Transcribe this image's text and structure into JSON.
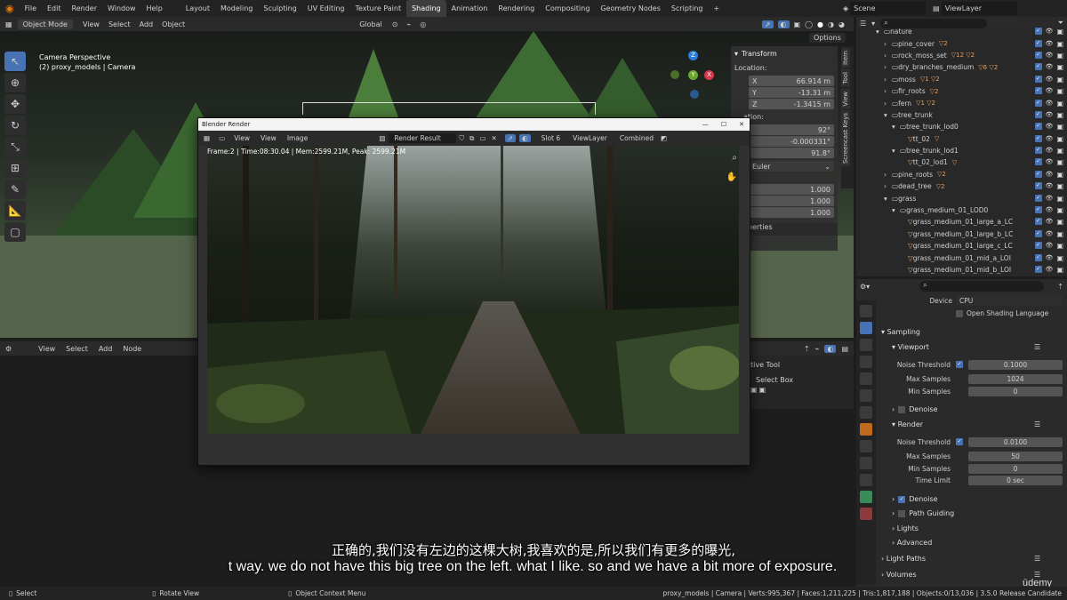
{
  "menu": {
    "items": [
      "File",
      "Edit",
      "Render",
      "Window",
      "Help"
    ]
  },
  "workspaces": {
    "tabs": [
      "Layout",
      "Modeling",
      "Sculpting",
      "UV Editing",
      "Texture Paint",
      "Shading",
      "Animation",
      "Rendering",
      "Compositing",
      "Geometry Nodes",
      "Scripting"
    ],
    "active": "Shading",
    "add": "+"
  },
  "scene": {
    "name": "Scene",
    "view_layer": "ViewLayer"
  },
  "viewport": {
    "mode": "Object Mode",
    "menus": [
      "View",
      "Select",
      "Add",
      "Object"
    ],
    "orientation": "Global",
    "options": "Options",
    "info_line1": "Camera Perspective",
    "info_line2": "(2) proxy_models | Camera"
  },
  "npanel": {
    "title": "Transform",
    "location": "Location:",
    "x_label": "X",
    "x_val": "66.914 m",
    "y_label": "Y",
    "y_val": "-13.31 m",
    "z_label": "Z",
    "z_val": "-1.3415 m",
    "rotation": "ation:",
    "r1": "92°",
    "r2": "-0.000331°",
    "r3": "91.8°",
    "euler": "Euler",
    "s1": "1.000",
    "s2": "1.000",
    "s3": "1.000",
    "properties": "operties",
    "tabs": [
      "Item",
      "Tool",
      "View",
      "Screencast Keys"
    ]
  },
  "node_editor": {
    "menus": [
      "View",
      "Select",
      "Add",
      "Node"
    ],
    "active_tool": "tive Tool",
    "select_box": "Select Box"
  },
  "render_window": {
    "title": "Blender Render",
    "menus": [
      "View",
      "View",
      "Image"
    ],
    "image_name": "Render Result",
    "slot": "Slot 6",
    "view_layer": "ViewLayer",
    "pass": "Combined",
    "stats": "Frame:2 | Time:08:30.04 | Mem:2599.21M, Peak: 2599.21M"
  },
  "outliner": {
    "rows": [
      {
        "name": "nature",
        "level": 0,
        "badge": ""
      },
      {
        "name": "pine_cover",
        "level": 1,
        "badge": "▽2"
      },
      {
        "name": "rock_moss_set",
        "level": 1,
        "badge": "▽12 ▽2"
      },
      {
        "name": "dry_branches_medium",
        "level": 1,
        "badge": "▽6 ▽2"
      },
      {
        "name": "moss",
        "level": 1,
        "badge": "▽1 ▽2"
      },
      {
        "name": "fir_roots",
        "level": 1,
        "badge": "▽2"
      },
      {
        "name": "fern",
        "level": 1,
        "badge": "▽1 ▽2"
      },
      {
        "name": "tree_trunk",
        "level": 1,
        "badge": ""
      },
      {
        "name": "tree_trunk_lod0",
        "level": 2,
        "badge": ""
      },
      {
        "name": "tt_02",
        "level": 3,
        "badge": "▽"
      },
      {
        "name": "tree_trunk_lod1",
        "level": 2,
        "badge": ""
      },
      {
        "name": "tt_02_lod1",
        "level": 3,
        "badge": "▽"
      },
      {
        "name": "pine_roots",
        "level": 1,
        "badge": "▽2"
      },
      {
        "name": "dead_tree",
        "level": 1,
        "badge": "▽2"
      },
      {
        "name": "grass",
        "level": 1,
        "badge": ""
      },
      {
        "name": "grass_medium_01_LOD0",
        "level": 2,
        "badge": ""
      },
      {
        "name": "grass_medium_01_large_a_LC",
        "level": 3,
        "badge": ""
      },
      {
        "name": "grass_medium_01_large_b_LC",
        "level": 3,
        "badge": ""
      },
      {
        "name": "grass_medium_01_large_c_LC",
        "level": 3,
        "badge": ""
      },
      {
        "name": "grass_medium_01_mid_a_LOI",
        "level": 3,
        "badge": ""
      },
      {
        "name": "grass_medium_01_mid_b_LOI",
        "level": 3,
        "badge": ""
      }
    ]
  },
  "properties": {
    "device_label": "Device",
    "device": "CPU",
    "osl": "Open Shading Language",
    "sampling": "Sampling",
    "viewport": "Viewport",
    "noise_threshold": "Noise Threshold",
    "vp_noise": "0.1000",
    "max_samples": "Max Samples",
    "vp_max": "1024",
    "min_samples": "Min Samples",
    "vp_min": "0",
    "denoise": "Denoise",
    "render": "Render",
    "r_noise": "0.0100",
    "r_max": "50",
    "r_min": "0",
    "time_limit": "Time Limit",
    "r_time": "0 sec",
    "path_guiding": "Path Guiding",
    "lights": "Lights",
    "advanced": "Advanced",
    "light_paths": "Light Paths",
    "volumes": "Volumes"
  },
  "subtitle": {
    "zh": "正确的,我们没有左边的这棵大树,我喜欢的是,所以我们有更多的曝光,",
    "en": "t way. we do not have this big tree on the left. what I like. so and we have a bit more of exposure."
  },
  "statusbar": {
    "select": "Select",
    "rotate": "Rotate View",
    "context": "Object Context Menu",
    "stats": "proxy_models | Camera | Verts:995,367 | Faces:1,211,225 | Tris:1,817,188 | Objects:0/13,036 | 3.5.0 Release Candidate"
  },
  "watermark": "ūdemy"
}
